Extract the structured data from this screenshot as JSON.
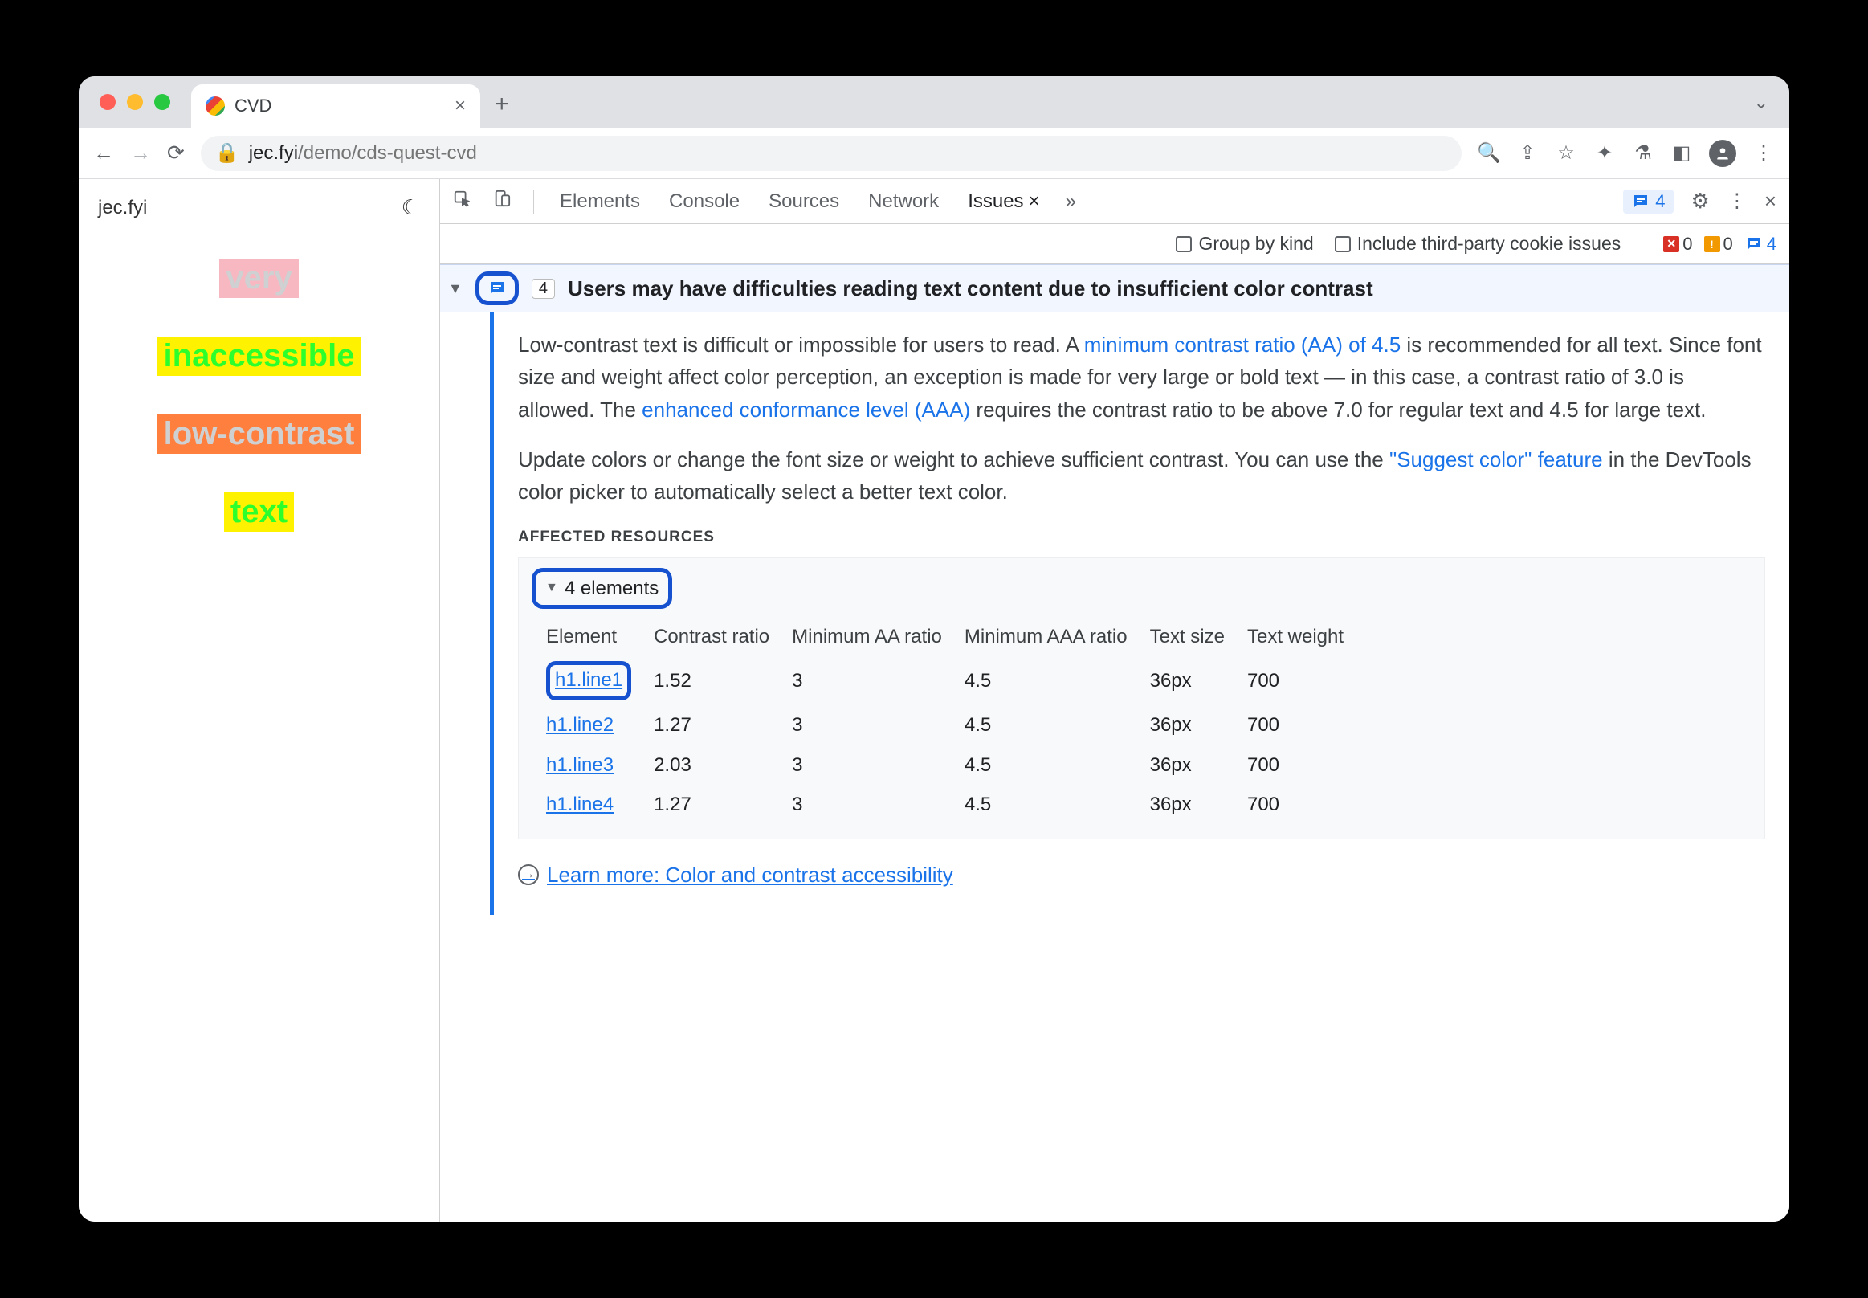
{
  "browser": {
    "tab_title": "CVD",
    "url_host": "jec.fyi",
    "url_path": "/demo/cds-quest-cvd"
  },
  "page": {
    "site": "jec.fyi",
    "words": [
      "very",
      "inaccessible",
      "low-contrast",
      "text"
    ]
  },
  "devtools": {
    "tabs": [
      "Elements",
      "Console",
      "Sources",
      "Network",
      "Issues"
    ],
    "active_tab": "Issues",
    "msg_count": "4",
    "filter": {
      "group_label": "Group by kind",
      "third_party_label": "Include third-party cookie issues"
    },
    "counts": {
      "err": "0",
      "warn": "0",
      "msg": "4"
    }
  },
  "issue": {
    "count": "4",
    "title": "Users may have difficulties reading text content due to insufficient color contrast",
    "para1_a": "Low-contrast text is difficult or impossible for users to read. A ",
    "link1": "minimum contrast ratio (AA) of 4.5",
    "para1_b": " is recommended for all text. Since font size and weight affect color perception, an exception is made for very large or bold text — in this case, a contrast ratio of 3.0 is allowed. The ",
    "link2": "enhanced conformance level (AAA)",
    "para1_c": " requires the contrast ratio to be above 7.0 for regular text and 4.5 for large text.",
    "para2_a": "Update colors or change the font size or weight to achieve sufficient contrast. You can use the ",
    "link3": "\"Suggest color\" feature",
    "para2_b": " in the DevTools color picker to automatically select a better text color.",
    "affected_title": "AFFECTED RESOURCES",
    "elements_label": "4 elements",
    "table": {
      "headers": [
        "Element",
        "Contrast ratio",
        "Minimum AA ratio",
        "Minimum AAA ratio",
        "Text size",
        "Text weight"
      ],
      "rows": [
        {
          "el": "h1.line1",
          "cr": "1.52",
          "aa": "3",
          "aaa": "4.5",
          "size": "36px",
          "wt": "700"
        },
        {
          "el": "h1.line2",
          "cr": "1.27",
          "aa": "3",
          "aaa": "4.5",
          "size": "36px",
          "wt": "700"
        },
        {
          "el": "h1.line3",
          "cr": "2.03",
          "aa": "3",
          "aaa": "4.5",
          "size": "36px",
          "wt": "700"
        },
        {
          "el": "h1.line4",
          "cr": "1.27",
          "aa": "3",
          "aaa": "4.5",
          "size": "36px",
          "wt": "700"
        }
      ]
    },
    "learn_more": "Learn more: Color and contrast accessibility"
  }
}
